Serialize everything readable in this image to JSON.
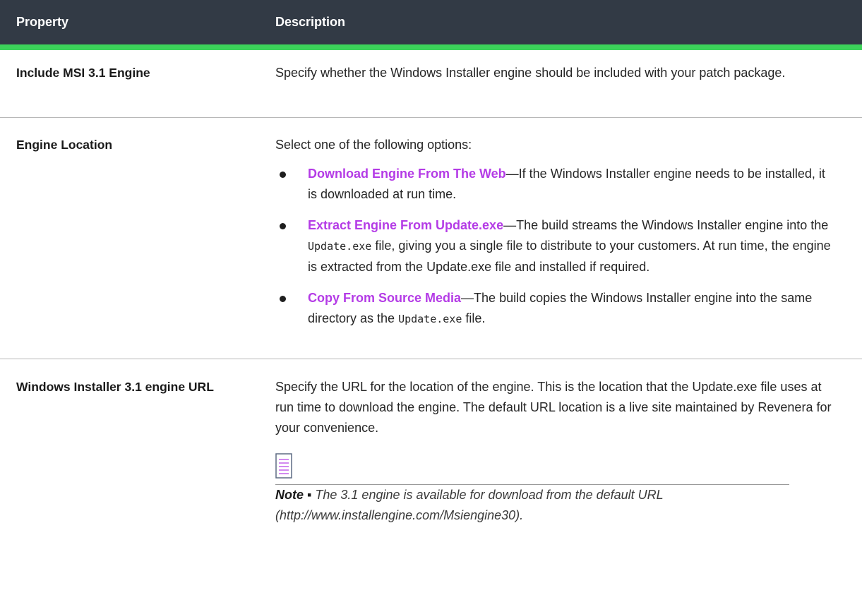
{
  "header": {
    "property": "Property",
    "description": "Description"
  },
  "rows": [
    {
      "property": "Include MSI 3.1 Engine",
      "description": "Specify whether the Windows Installer engine should be included with your patch package."
    },
    {
      "property": "Engine Location",
      "intro": "Select one of the following options:",
      "options": [
        {
          "name": "Download Engine From The Web",
          "text": "—If the Windows Installer engine needs to be installed, it is downloaded at run time."
        },
        {
          "name": "Extract Engine From Update.exe",
          "text_before": "—The build streams the Windows Installer engine into the ",
          "code": "Update.exe",
          "text_after": " file, giving you a single file to distribute to your customers. At run time, the engine is extracted from the Update.exe file and installed if required."
        },
        {
          "name": "Copy From Source Media",
          "text_before": "—The build copies the Windows Installer engine into the same directory as the ",
          "code": "Update.exe",
          "text_after": " file."
        }
      ]
    },
    {
      "property": "Windows Installer 3.1 engine URL",
      "description": "Specify the URL for the location of the engine. This is the location that the Update.exe file uses at run time to download the engine. The default URL location is a live site maintained by Revenera for your convenience.",
      "note_icon": "note-icon",
      "note_label": "Note ▪",
      "note_text": " The 3.1 engine is available for download from the default URL (http://www.installengine.com/Msiengine30)."
    }
  ],
  "colors": {
    "header_bg": "#323a45",
    "header_accent": "#3cd35a",
    "link": "#b43be6"
  }
}
